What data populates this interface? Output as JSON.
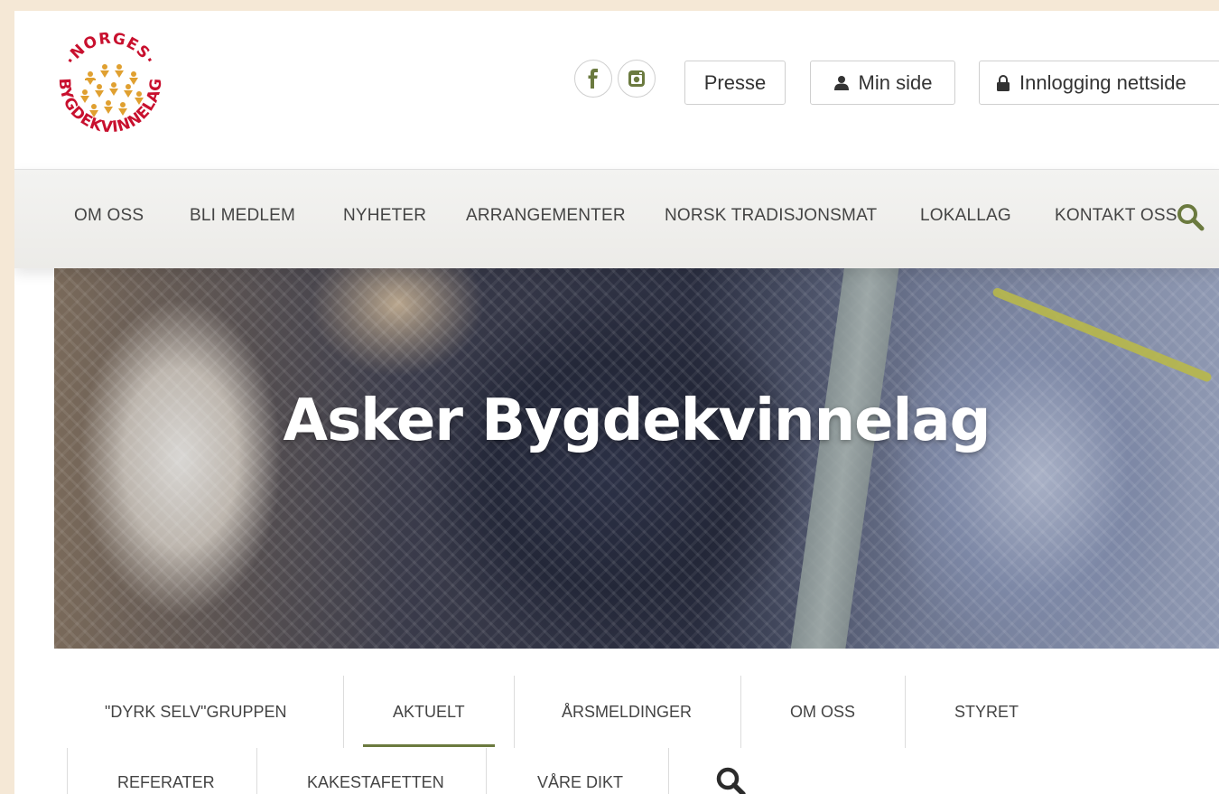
{
  "logo": {
    "top_text": "NORGES",
    "ring_text": "BYGDEKVINNELAG",
    "brand_color": "#c8102e",
    "figure_color": "#e0a030"
  },
  "header": {
    "social": [
      {
        "name": "facebook-icon",
        "glyph": "f"
      },
      {
        "name": "instagram-icon"
      }
    ],
    "presse_label": "Presse",
    "minside_label": "Min side",
    "login_label": "Innlogging nettside"
  },
  "nav": {
    "items": [
      "OM OSS",
      "BLI MEDLEM",
      "NYHETER",
      "ARRANGEMENTER",
      "NORSK TRADISJONSMAT",
      "LOKALLAG",
      "KONTAKT OSS"
    ],
    "search_icon": "search-icon",
    "accent": "#6b7a3f"
  },
  "hero": {
    "title": "Asker Bygdekvinnelag"
  },
  "subnav": {
    "row1": [
      "\"DYRK SELV\"GRUPPEN",
      "AKTUELT",
      "ÅRSMELDINGER",
      "OM OSS",
      "STYRET"
    ],
    "row2": [
      "REFERATER",
      "KAKESTAFETTEN",
      "VÅRE DIKT"
    ],
    "active": "AKTUELT"
  }
}
